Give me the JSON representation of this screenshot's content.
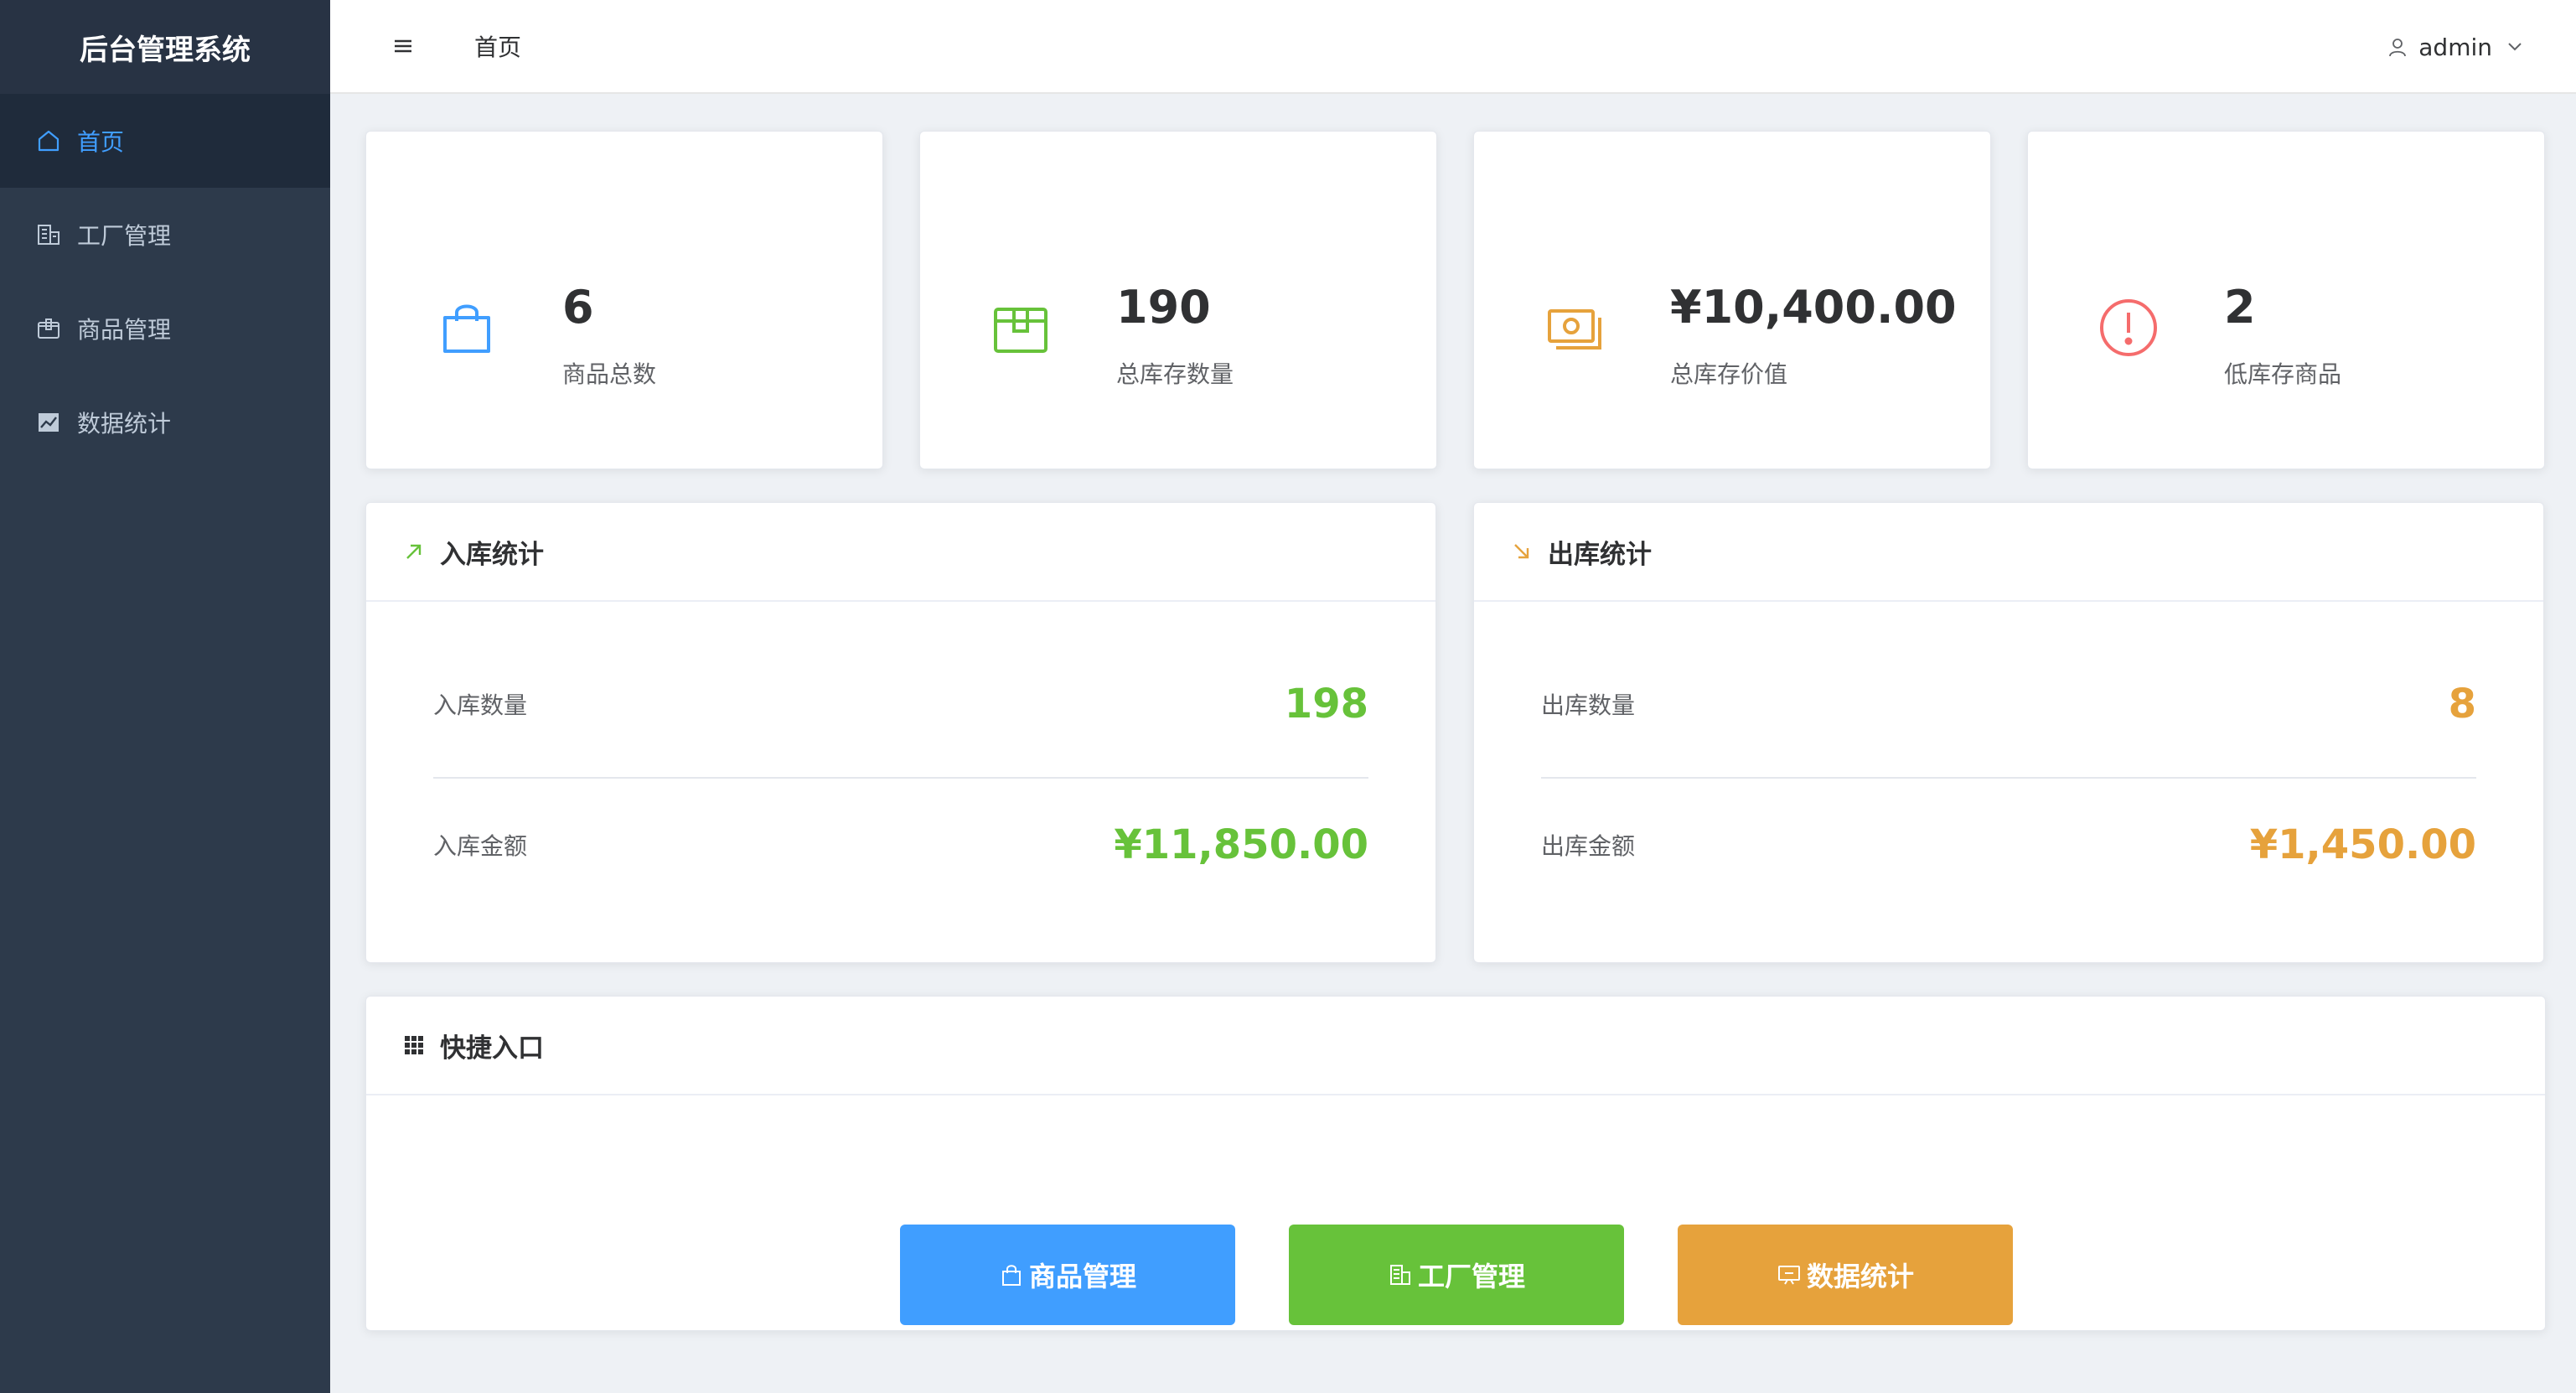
{
  "sidebar": {
    "brand": "后台管理系统",
    "items": [
      {
        "label": "首页"
      },
      {
        "label": "工厂管理"
      },
      {
        "label": "商品管理"
      },
      {
        "label": "数据统计"
      }
    ]
  },
  "header": {
    "breadcrumb": "首页",
    "username": "admin"
  },
  "stats": [
    {
      "value": "6",
      "label": "商品总数",
      "icon": "shopping-bag-icon",
      "color": "#409eff"
    },
    {
      "value": "190",
      "label": "总库存数量",
      "icon": "box-icon",
      "color": "#67c23a"
    },
    {
      "value": "¥10,400.00",
      "label": "总库存价值",
      "icon": "money-icon",
      "color": "#e6a23c"
    },
    {
      "value": "2",
      "label": "低库存商品",
      "icon": "warning-icon",
      "color": "#f56c6c"
    }
  ],
  "inbound": {
    "title": "入库统计",
    "rows": [
      {
        "label": "入库数量",
        "value": "198"
      },
      {
        "label": "入库金额",
        "value": "¥11,850.00"
      }
    ],
    "color": "#67c23a"
  },
  "outbound": {
    "title": "出库统计",
    "rows": [
      {
        "label": "出库数量",
        "value": "8"
      },
      {
        "label": "出库金额",
        "value": "¥1,450.00"
      }
    ],
    "color": "#e6a23c"
  },
  "quick": {
    "title": "快捷入口",
    "buttons": [
      {
        "label": "商品管理",
        "color": "#409eff"
      },
      {
        "label": "工厂管理",
        "color": "#67c23a"
      },
      {
        "label": "数据统计",
        "color": "#e6a23c"
      }
    ]
  }
}
